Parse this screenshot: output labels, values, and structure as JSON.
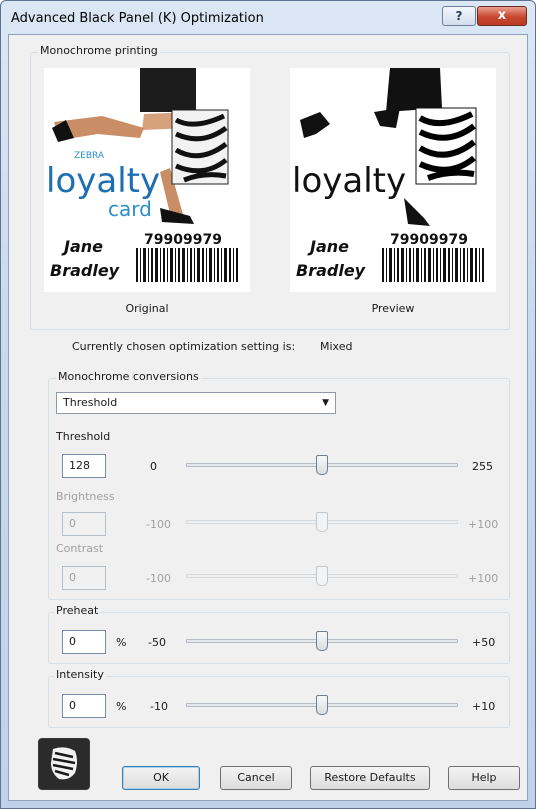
{
  "window": {
    "title": "Advanced Black Panel (K) Optimization",
    "help_label": "?",
    "close_label": "x"
  },
  "monochrome_printing": {
    "label": "Monochrome printing",
    "original": {
      "caption": "Original",
      "brand": "ZEBRA",
      "word1": "loyalty",
      "word2": "card",
      "number": "79909979",
      "first_name": "Jane",
      "last_name": "Bradley"
    },
    "preview": {
      "caption": "Preview",
      "word1": "loyalty",
      "number": "79909979",
      "first_name": "Jane",
      "last_name": "Bradley"
    }
  },
  "status": {
    "prefix": "Currently chosen optimization setting is:",
    "value": "Mixed"
  },
  "conversions": {
    "label": "Monochrome conversions",
    "selected": "Threshold",
    "threshold": {
      "label": "Threshold",
      "value": "128",
      "min": "0",
      "max": "255",
      "level": 0.5
    },
    "brightness": {
      "label": "Brightness",
      "value": "0",
      "min": "-100",
      "max": "+100",
      "level": 0.5
    },
    "contrast": {
      "label": "Contrast",
      "value": "0",
      "min": "-100",
      "max": "+100",
      "level": 0.5
    }
  },
  "preheat": {
    "label": "Preheat",
    "value": "0",
    "unit": "%",
    "min": "-50",
    "max": "+50",
    "level": 0.5
  },
  "intensity": {
    "label": "Intensity",
    "value": "0",
    "unit": "%",
    "min": "-10",
    "max": "+10",
    "level": 0.5
  },
  "buttons": {
    "ok": "OK",
    "cancel": "Cancel",
    "restore": "Restore Defaults",
    "help": "Help"
  },
  "logo": {
    "icon": "zebra-logo-icon"
  }
}
